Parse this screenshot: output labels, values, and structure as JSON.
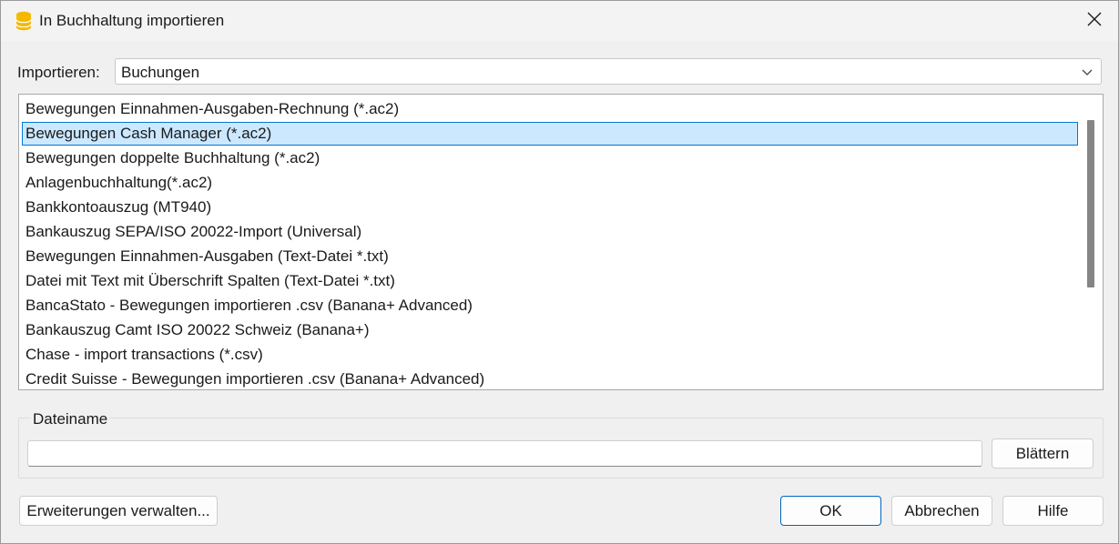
{
  "window": {
    "title": "In Buchhaltung importieren",
    "close_icon": "close-icon",
    "app_icon": "database-icon"
  },
  "import": {
    "label": "Importieren:",
    "selected": "Buchungen"
  },
  "list": {
    "selected_index": 1,
    "items": [
      "Bewegungen Einnahmen-Ausgaben-Rechnung (*.ac2)",
      "Bewegungen Cash Manager (*.ac2)",
      "Bewegungen doppelte Buchhaltung (*.ac2)",
      "Anlagenbuchhaltung(*.ac2)",
      "Bankkontoauszug (MT940)",
      "Bankauszug SEPA/ISO 20022-Import (Universal)",
      "Bewegungen Einnahmen-Ausgaben (Text-Datei *.txt)",
      "Datei mit Text mit Überschrift Spalten (Text-Datei *.txt)",
      "BancaStato - Bewegungen importieren .csv (Banana+ Advanced)",
      "Bankauszug Camt ISO 20022 Schweiz (Banana+)",
      "Chase - import transactions (*.csv)",
      "Credit Suisse - Bewegungen importieren .csv (Banana+ Advanced)"
    ]
  },
  "file": {
    "group_label": "Dateiname",
    "value": "",
    "browse_label": "Blättern"
  },
  "buttons": {
    "extensions": "Erweiterungen verwalten...",
    "ok": "OK",
    "cancel": "Abbrechen",
    "help": "Hilfe"
  },
  "colors": {
    "selection_bg": "#cce8ff",
    "selection_border": "#0078d7",
    "primary_border": "#0067c0",
    "app_icon": "#f5b800"
  }
}
